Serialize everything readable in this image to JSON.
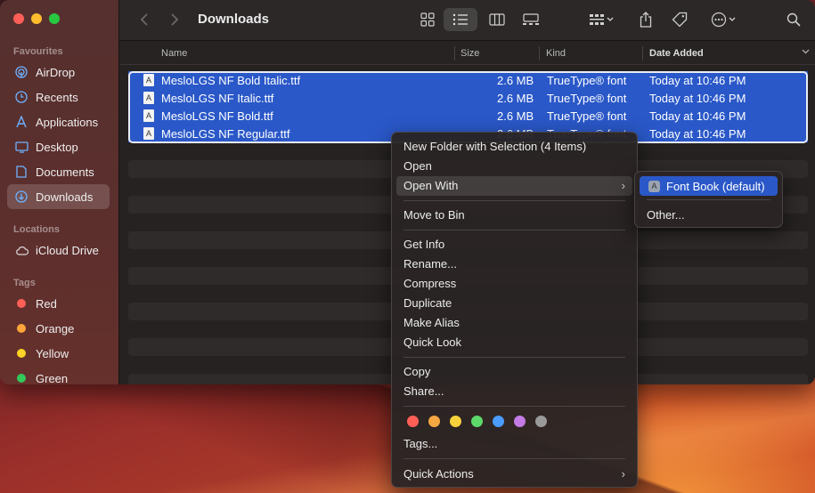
{
  "window": {
    "title": "Downloads"
  },
  "sidebar": {
    "favourites_title": "Favourites",
    "favourites": [
      {
        "label": "AirDrop",
        "icon": "airdrop-icon"
      },
      {
        "label": "Recents",
        "icon": "clock-icon"
      },
      {
        "label": "Applications",
        "icon": "applications-icon"
      },
      {
        "label": "Desktop",
        "icon": "desktop-icon"
      },
      {
        "label": "Documents",
        "icon": "document-icon"
      },
      {
        "label": "Downloads",
        "icon": "download-icon",
        "active": true
      }
    ],
    "locations_title": "Locations",
    "locations": [
      {
        "label": "iCloud Drive",
        "icon": "cloud-icon"
      }
    ],
    "tags_title": "Tags",
    "tags": [
      {
        "label": "Red",
        "color": "#ff5f57"
      },
      {
        "label": "Orange",
        "color": "#ffa53a"
      },
      {
        "label": "Yellow",
        "color": "#ffd426"
      },
      {
        "label": "Green",
        "color": "#34c759"
      }
    ]
  },
  "columns": {
    "name": "Name",
    "size": "Size",
    "kind": "Kind",
    "date": "Date Added"
  },
  "files": [
    {
      "name": "MesloLGS NF Bold Italic.ttf",
      "size": "2.6 MB",
      "kind": "TrueType® font",
      "date": "Today at 10:46 PM"
    },
    {
      "name": "MesloLGS NF Italic.ttf",
      "size": "2.6 MB",
      "kind": "TrueType® font",
      "date": "Today at 10:46 PM"
    },
    {
      "name": "MesloLGS NF Bold.ttf",
      "size": "2.6 MB",
      "kind": "TrueType® font",
      "date": "Today at 10:46 PM"
    },
    {
      "name": "MesloLGS NF Regular.ttf",
      "size": "2.6 MB",
      "kind": "TrueType® font",
      "date": "Today at 10:46 PM"
    }
  ],
  "context_menu": {
    "new_folder": "New Folder with Selection (4 Items)",
    "open": "Open",
    "open_with": "Open With",
    "move_to_bin": "Move to Bin",
    "get_info": "Get Info",
    "rename": "Rename...",
    "compress": "Compress",
    "duplicate": "Duplicate",
    "make_alias": "Make Alias",
    "quick_look": "Quick Look",
    "copy": "Copy",
    "share": "Share...",
    "tag_colors": [
      "#ff5f57",
      "#f5a742",
      "#f7d23c",
      "#5dd86a",
      "#4a9cff",
      "#c57be6",
      "#9a9a9a"
    ],
    "tags": "Tags...",
    "quick_actions": "Quick Actions"
  },
  "submenu": {
    "default_app": "Font Book (default)",
    "other": "Other..."
  }
}
